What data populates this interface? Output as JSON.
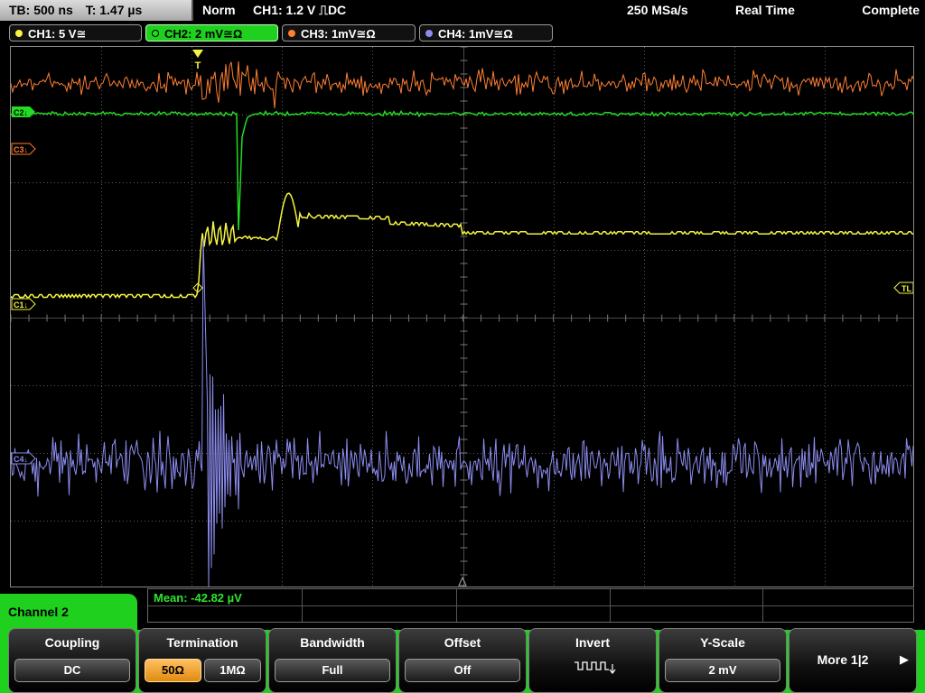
{
  "status": {
    "timebase": "TB: 500 ns",
    "trigger_time": "T: 1.47 µs",
    "mode": "Norm",
    "trigger": "CH1: 1.2 V ⎍DC",
    "sample_rate": "250 MSa/s",
    "acq_mode": "Real Time",
    "state": "Complete"
  },
  "channels": [
    {
      "label": "CH1: 5 V≅",
      "color": "#f5f542",
      "active": false
    },
    {
      "label": "CH2: 2 mV≅Ω",
      "color": "#22dd22",
      "active": true
    },
    {
      "label": "CH3: 1mV≅Ω",
      "color": "#ff7f32",
      "active": false
    },
    {
      "label": "CH4: 1mV≅Ω",
      "color": "#8c8cf0",
      "active": false
    }
  ],
  "markers": {
    "c2": "C2↓",
    "c3": "C3↓",
    "c1": "C1↓",
    "c4": "C4↓",
    "trigger_level": "TL",
    "trigger_pos": "T"
  },
  "measurement": {
    "mean": "Mean: -42.82 µV"
  },
  "menu": {
    "title": "Channel 2",
    "coupling": {
      "label": "Coupling",
      "value": "DC"
    },
    "termination": {
      "label": "Termination",
      "opt1": "50Ω",
      "opt2": "1MΩ"
    },
    "bandwidth": {
      "label": "Bandwidth",
      "value": "Full"
    },
    "offset": {
      "label": "Offset",
      "value": "Off"
    },
    "invert": {
      "label": "Invert"
    },
    "yscale": {
      "label": "Y-Scale",
      "value": "2 mV"
    },
    "more": {
      "label": "More 1|2"
    }
  }
}
